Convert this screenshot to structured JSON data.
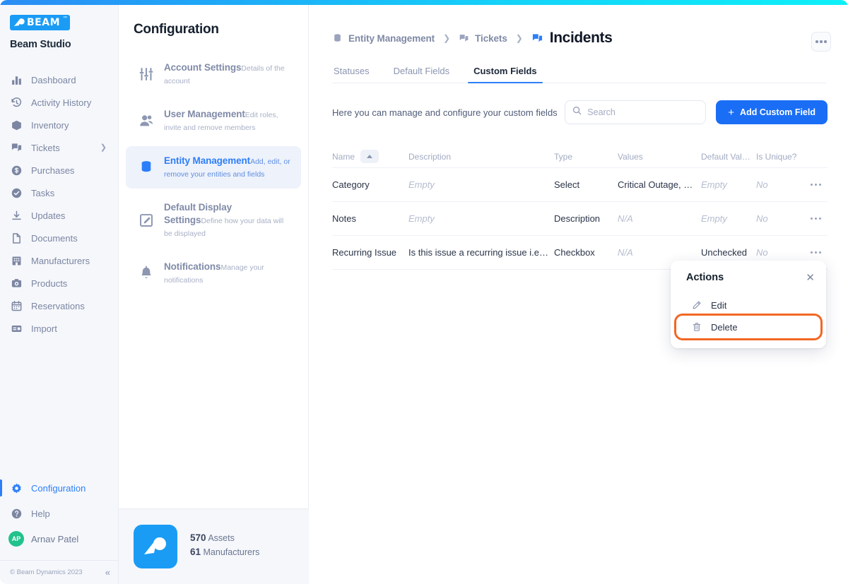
{
  "app": {
    "logo_text": "BEAM",
    "logo_tm": "™",
    "brand": "Beam Studio"
  },
  "sidebar": {
    "items": [
      {
        "label": "Dashboard",
        "icon": "chart-bar-icon",
        "active": false,
        "chevron": false
      },
      {
        "label": "Activity History",
        "icon": "history-icon",
        "active": false,
        "chevron": false
      },
      {
        "label": "Inventory",
        "icon": "box-icon",
        "active": false,
        "chevron": false
      },
      {
        "label": "Tickets",
        "icon": "tickets-icon",
        "active": false,
        "chevron": true
      },
      {
        "label": "Purchases",
        "icon": "dollar-circle-icon",
        "active": false,
        "chevron": false
      },
      {
        "label": "Tasks",
        "icon": "check-circle-icon",
        "active": false,
        "chevron": false
      },
      {
        "label": "Updates",
        "icon": "download-icon",
        "active": false,
        "chevron": false
      },
      {
        "label": "Documents",
        "icon": "document-icon",
        "active": false,
        "chevron": false
      },
      {
        "label": "Manufacturers",
        "icon": "building-icon",
        "active": false,
        "chevron": false
      },
      {
        "label": "Products",
        "icon": "camera-icon",
        "active": false,
        "chevron": false
      },
      {
        "label": "Reservations",
        "icon": "calendar-icon",
        "active": false,
        "chevron": false
      },
      {
        "label": "Import",
        "icon": "import-icon",
        "active": false,
        "chevron": false
      }
    ],
    "bottom_items": [
      {
        "label": "Configuration",
        "icon": "gear-icon",
        "active": true
      },
      {
        "label": "Help",
        "icon": "question-circle-icon",
        "active": false
      }
    ],
    "user": {
      "initials": "AP",
      "name": "Arnav Patel",
      "avatar_color": "#22c28c"
    },
    "footer": {
      "copyright": "© Beam Dynamics 2023",
      "collapse_icon": "chevron-double-left-icon"
    },
    "chevron_glyph": "❯"
  },
  "config": {
    "title": "Configuration",
    "items": [
      {
        "title": "Account Settings",
        "subtitle": "Details of the account",
        "icon": "sliders-icon",
        "active": false
      },
      {
        "title": "User Management",
        "subtitle": "Edit roles, invite and remove members",
        "icon": "users-icon",
        "active": false
      },
      {
        "title": "Entity Management",
        "subtitle": "Add, edit, or remove your entities and fields",
        "icon": "database-icon",
        "active": true
      },
      {
        "title": "Default Display Settings",
        "subtitle": "Define how your data will be displayed",
        "icon": "edit-square-icon",
        "active": false
      },
      {
        "title": "Notifications",
        "subtitle": "Manage your notifications",
        "icon": "bell-icon",
        "active": false
      }
    ],
    "stats": [
      {
        "value": "570",
        "label": "Assets"
      },
      {
        "value": "61",
        "label": "Manufacturers"
      }
    ]
  },
  "main": {
    "breadcrumb": [
      {
        "label": "Entity Management",
        "icon": "database-icon",
        "current": false
      },
      {
        "label": "Tickets",
        "icon": "tickets-icon",
        "current": false
      },
      {
        "label": "Incidents",
        "icon": "tickets-icon",
        "current": true
      }
    ],
    "breadcrumb_separator": "❯",
    "kebab_name": "more-options-button",
    "tabs": [
      {
        "label": "Statuses",
        "active": false
      },
      {
        "label": "Default Fields",
        "active": false
      },
      {
        "label": "Custom Fields",
        "active": true
      }
    ],
    "toolbar": {
      "hint": "Here you can manage and configure your custom fields",
      "search_placeholder": "Search",
      "search_value": "",
      "add_label": "Add Custom Field",
      "add_plus": "+"
    },
    "table": {
      "columns": [
        "Name",
        "Description",
        "Type",
        "Values",
        "Default Value",
        "Is Unique?"
      ],
      "sorted_column": "Name",
      "sort_direction": "asc",
      "rows": [
        {
          "name": "Category",
          "description": "Empty",
          "description_muted": true,
          "type": "Select",
          "values": "Critical Outage, …",
          "values_muted": false,
          "default_value": "Empty",
          "default_muted": true,
          "is_unique": "No",
          "unique_muted": true
        },
        {
          "name": "Notes",
          "description": "Empty",
          "description_muted": true,
          "type": "Description",
          "values": "N/A",
          "values_muted": true,
          "default_value": "Empty",
          "default_muted": true,
          "is_unique": "No",
          "unique_muted": true
        },
        {
          "name": "Recurring Issue",
          "description": "Is this issue a recurring issue i.e....",
          "description_muted": false,
          "type": "Checkbox",
          "values": "N/A",
          "values_muted": true,
          "default_value": "Unchecked",
          "default_muted": false,
          "is_unique": "No",
          "unique_muted": true
        }
      ]
    },
    "popover": {
      "title": "Actions",
      "close_glyph": "✕",
      "items": [
        {
          "label": "Edit",
          "icon": "pencil-icon",
          "highlighted": false
        },
        {
          "label": "Delete",
          "icon": "trash-icon",
          "highlighted": true
        }
      ]
    }
  },
  "colors": {
    "accent_blue": "#2d7ff9",
    "button_blue": "#1a6ef5",
    "logo_blue": "#1a9cf5",
    "highlight_orange": "#f26724",
    "avatar_green": "#22c28c"
  }
}
